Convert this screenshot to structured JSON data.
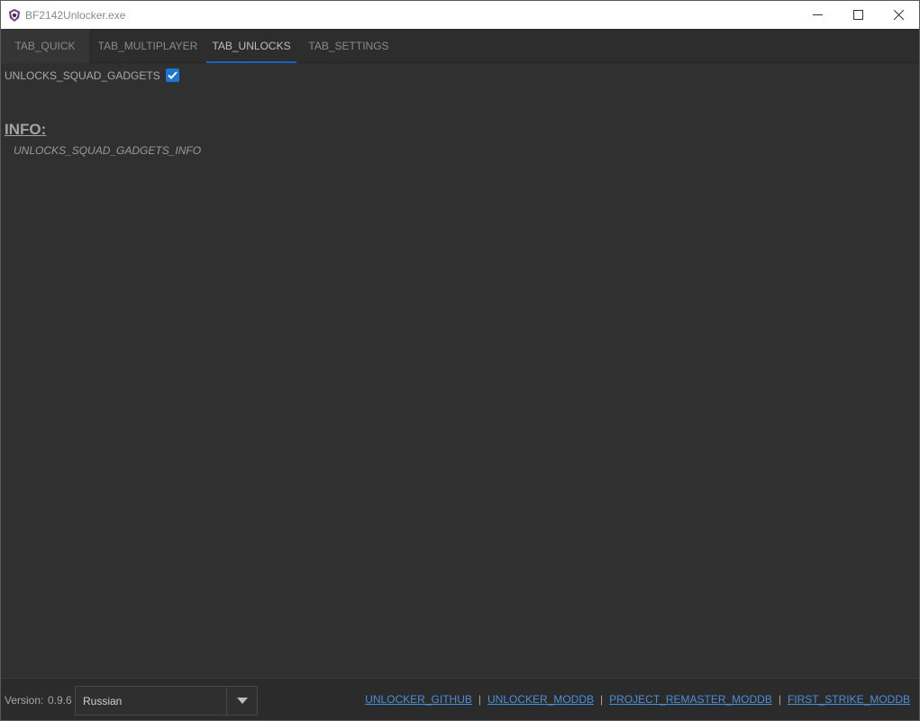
{
  "window": {
    "title": "BF2142Unlocker.exe"
  },
  "tabs": [
    {
      "label": "TAB_QUICK",
      "active": false
    },
    {
      "label": "TAB_MULTIPLAYER",
      "active": false
    },
    {
      "label": "TAB_UNLOCKS",
      "active": true
    },
    {
      "label": "TAB_SETTINGS",
      "active": false
    }
  ],
  "content": {
    "option_label": "UNLOCKS_SQUAD_GADGETS",
    "option_checked": true,
    "info_heading": "INFO:",
    "info_text": "UNLOCKS_SQUAD_GADGETS_INFO"
  },
  "footer": {
    "version_label": "Version:",
    "version_value": "0.9.6",
    "language": "Russian",
    "links": [
      "UNLOCKER_GITHUB",
      "UNLOCKER_MODDB",
      "PROJECT_REMASTER_MODDB",
      "FIRST_STRIKE_MODDB"
    ],
    "separator": "|"
  },
  "colors": {
    "accent": "#1565c0",
    "checkbox": "#1976d2",
    "link": "#4a8fd9",
    "background": "#303030"
  }
}
